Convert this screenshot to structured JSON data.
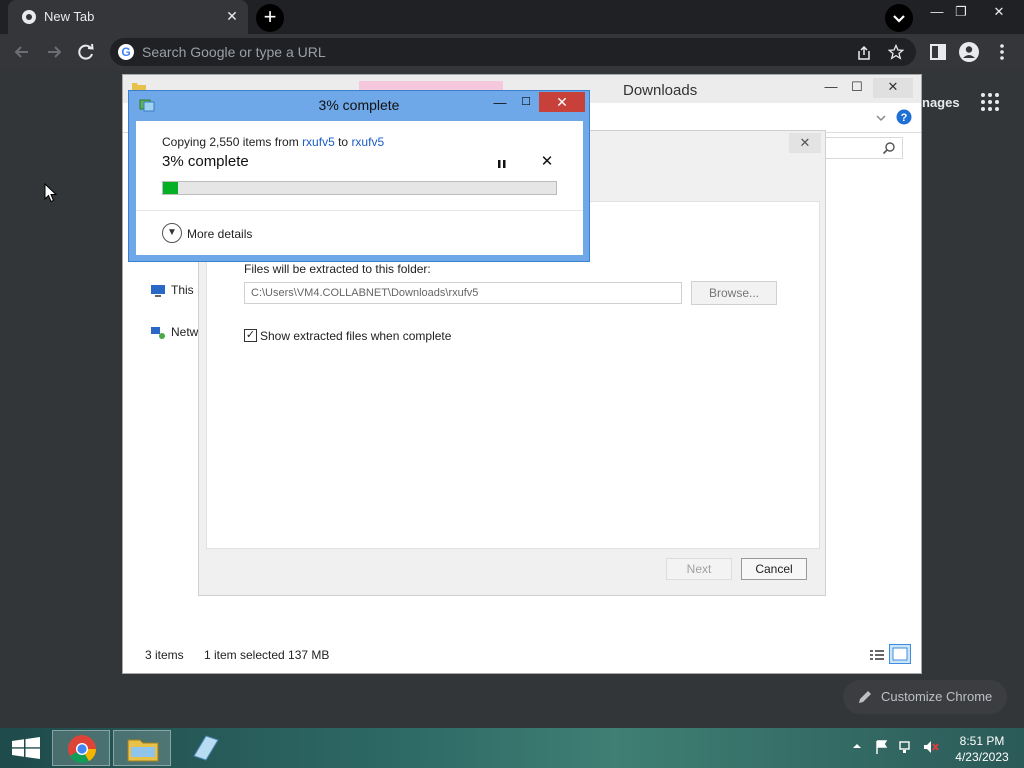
{
  "browser": {
    "tab_title": "New Tab",
    "tab_close": "✕",
    "new_tab": "+",
    "omnibox_placeholder": "Search Google or type a URL",
    "ntp_images_partial": "nages",
    "customize_label": "Customize Chrome",
    "window_controls": {
      "minimize": "—",
      "restore": "❐",
      "close": "✕"
    }
  },
  "explorer": {
    "title": "Downloads",
    "nav_this_pc": "This I",
    "nav_network": "Netw",
    "status_items": "3 items",
    "status_selected": "1 item selected  137 MB",
    "controls": {
      "minimize": "—",
      "maximize": "☐",
      "close": "✕"
    }
  },
  "extract_wizard": {
    "close": "✕",
    "folder_label": "Files will be extracted to this folder:",
    "path": "C:\\Users\\VM4.COLLABNET\\Downloads\\rxufv5",
    "browse_label": "Browse...",
    "show_files_label": "Show extracted files when complete",
    "show_files_checked": true,
    "next_label": "Next",
    "cancel_label": "Cancel"
  },
  "copy_dialog": {
    "title": "3% complete",
    "copy_prefix": "Copying 2,550 items from ",
    "source": "rxufv5",
    "to_word": " to ",
    "destination": "rxufv5",
    "percent_label": "3% complete",
    "progress": 0.03,
    "more_details": "More details",
    "controls": {
      "minimize": "—",
      "maximize": "☐",
      "close": "✕"
    },
    "progress_color": "#06b025"
  },
  "taskbar": {
    "time": "8:51 PM",
    "date": "4/23/2023",
    "items": [
      "start-button",
      "chrome-icon",
      "file-explorer-icon",
      "notepad-icon"
    ]
  }
}
